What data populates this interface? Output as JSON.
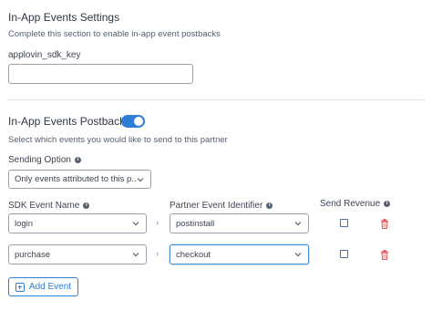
{
  "inapp_settings": {
    "title": "In-App Events Settings",
    "description": "Complete this section to enable in-app event postbacks",
    "sdk_key_label": "applovin_sdk_key",
    "sdk_key_value": ""
  },
  "postback": {
    "title": "In-App Events Postback",
    "toggle_on": true,
    "description": "Select which events you would like to send to this partner",
    "sending_option_label": "Sending Option",
    "sending_option_value": "Only events attributed to this p..."
  },
  "columns": {
    "sdk_event": "SDK Event Name",
    "partner_event": "Partner Event Identifier",
    "send_revenue": "Send Revenue"
  },
  "events": [
    {
      "sdk_event": "login",
      "partner_event": "postinstall",
      "send_revenue": false
    },
    {
      "sdk_event": "purchase",
      "partner_event": "checkout",
      "send_revenue": false
    }
  ],
  "add_event_label": "Add Event",
  "colors": {
    "accent": "#2e7dd7",
    "danger": "#e05a5a"
  }
}
